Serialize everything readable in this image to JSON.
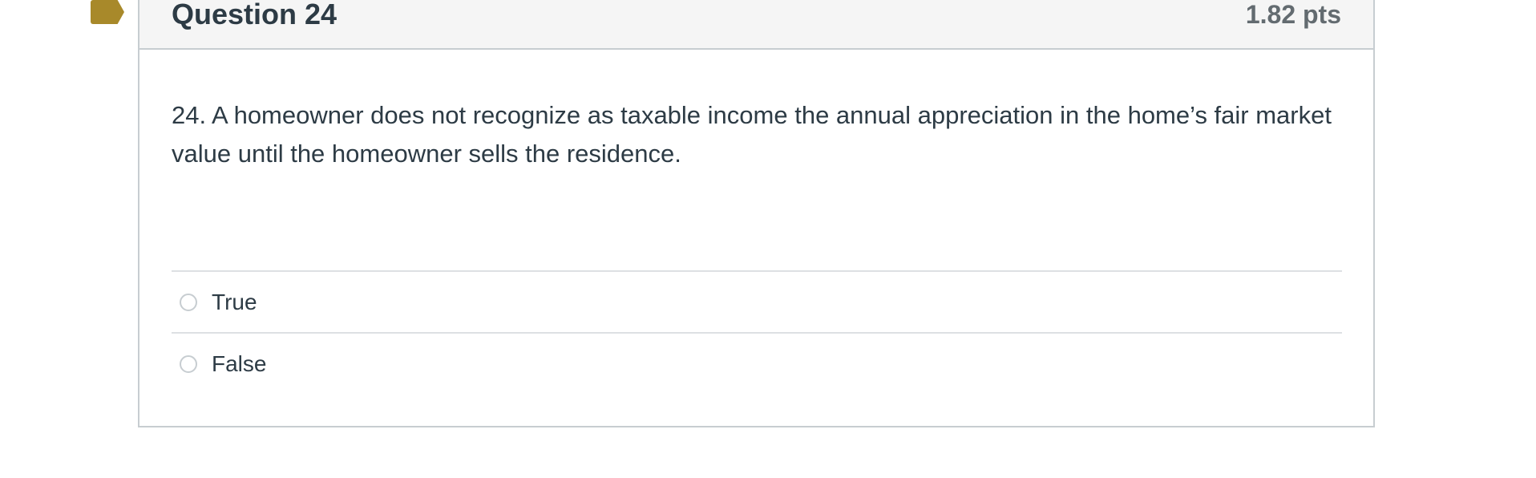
{
  "question": {
    "title": "Question 24",
    "points": "1.82 pts",
    "text": "24.  A homeowner does not recognize as taxable income the annual appreciation in the home’s fair market value until the homeowner sells the residence.",
    "answers": [
      {
        "label": "True"
      },
      {
        "label": "False"
      }
    ]
  },
  "icons": {
    "flag": "bookmark-flag-icon"
  },
  "colors": {
    "flag": "#a8892a",
    "header_bg": "#f5f5f5",
    "border": "#c7cdd1",
    "text": "#2d3b45",
    "points_text": "#636b70"
  }
}
